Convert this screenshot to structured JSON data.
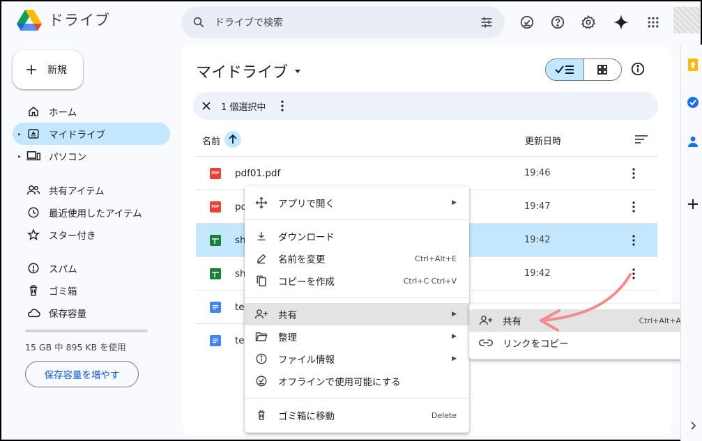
{
  "header": {
    "app_name": "ドライブ",
    "search_placeholder": "ドライブで検索"
  },
  "sidebar": {
    "new_label": "新規",
    "items": [
      {
        "label": "ホーム",
        "icon": "home-icon"
      },
      {
        "label": "マイドライブ",
        "icon": "my-drive-icon",
        "active": true
      },
      {
        "label": "パソコン",
        "icon": "computer-icon"
      },
      {
        "label": "共有アイテム",
        "icon": "shared-icon"
      },
      {
        "label": "最近使用したアイテム",
        "icon": "clock-icon"
      },
      {
        "label": "スター付き",
        "icon": "star-icon"
      },
      {
        "label": "スパム",
        "icon": "spam-icon"
      },
      {
        "label": "ゴミ箱",
        "icon": "trash-icon"
      },
      {
        "label": "保存容量",
        "icon": "cloud-icon"
      }
    ],
    "storage_text": "15 GB 中 895 KB を使用",
    "storage_button": "保存容量を増やす"
  },
  "main": {
    "title": "マイドライブ",
    "selection_text": "1 個選択中",
    "col_name": "名前",
    "col_modified": "更新日時",
    "files": [
      {
        "name": "pdf01.pdf",
        "type": "pdf",
        "time": "19:46",
        "selected": false
      },
      {
        "name": "pc",
        "type": "pdf",
        "time": "19:47",
        "selected": false
      },
      {
        "name": "sh",
        "type": "sheet",
        "time": "19:42",
        "selected": true
      },
      {
        "name": "sh",
        "type": "sheet",
        "time": "19:42",
        "selected": false
      },
      {
        "name": "te",
        "type": "doc",
        "time": "",
        "selected": false
      },
      {
        "name": "te",
        "type": "doc",
        "time": "",
        "selected": false
      }
    ]
  },
  "context_menu": {
    "open_with": "アプリで開く",
    "download": "ダウンロード",
    "rename": "名前を変更",
    "rename_shortcut": "Ctrl+Alt+E",
    "copy": "コピーを作成",
    "copy_shortcut": "Ctrl+C Ctrl+V",
    "share": "共有",
    "organize": "整理",
    "file_info": "ファイル情報",
    "offline": "オフラインで使用可能にする",
    "trash": "ゴミ箱に移動",
    "trash_shortcut": "Delete"
  },
  "share_submenu": {
    "share": "共有",
    "share_shortcut": "Ctrl+Alt+A",
    "copy_link": "リンクをコピー"
  },
  "colors": {
    "accent": "#0b57d0",
    "selected_bg": "#c2e7ff",
    "pdf_red": "#ea4335",
    "sheet_green": "#188038",
    "doc_blue": "#4285f4",
    "annotation_arrow": "#f28b8b"
  }
}
